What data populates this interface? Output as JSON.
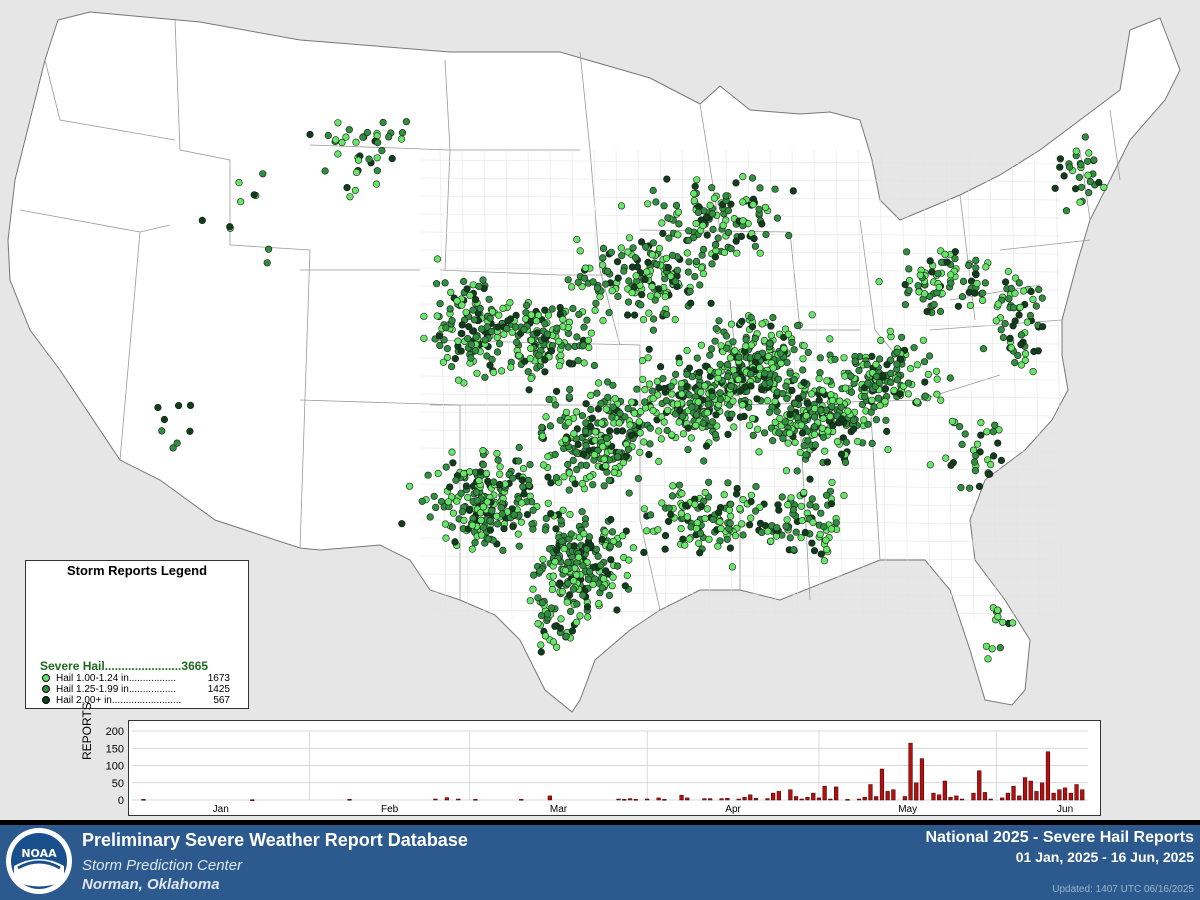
{
  "legend": {
    "title": "Storm Reports Legend",
    "summary_label": "Severe Hail.......................",
    "summary_count": "3665",
    "items": [
      {
        "label": "Hail 1.00-1.24 in.................",
        "count": "1673",
        "color": "#66e666"
      },
      {
        "label": "Hail 1.25-1.99 in.................",
        "count": "1425",
        "color": "#2f8f3f"
      },
      {
        "label": "Hail 2.00+ in.........................",
        "count": "567",
        "color": "#0f3f1a"
      }
    ],
    "summary_color": "#1e6a1e"
  },
  "chart": {
    "ylabel": "REPORTS",
    "yticks": [
      "0",
      "50",
      "100",
      "150",
      "200"
    ],
    "ymax": 200,
    "months": [
      "Jan",
      "Feb",
      "Mar",
      "Apr",
      "May",
      "Jun"
    ],
    "bar_color": "#b40f0f",
    "days": 167,
    "bars": [
      [
        2,
        2
      ],
      [
        21,
        1
      ],
      [
        38,
        2
      ],
      [
        53,
        3
      ],
      [
        55,
        7
      ],
      [
        57,
        3
      ],
      [
        60,
        2
      ],
      [
        68,
        2
      ],
      [
        73,
        12
      ],
      [
        85,
        3
      ],
      [
        86,
        2
      ],
      [
        87,
        4
      ],
      [
        88,
        2
      ],
      [
        90,
        3
      ],
      [
        92,
        6
      ],
      [
        93,
        2
      ],
      [
        96,
        14
      ],
      [
        97,
        6
      ],
      [
        100,
        4
      ],
      [
        101,
        4
      ],
      [
        103,
        4
      ],
      [
        104,
        5
      ],
      [
        106,
        3
      ],
      [
        107,
        8
      ],
      [
        108,
        15
      ],
      [
        109,
        5
      ],
      [
        111,
        4
      ],
      [
        112,
        20
      ],
      [
        113,
        25
      ],
      [
        115,
        30
      ],
      [
        116,
        10
      ],
      [
        117,
        3
      ],
      [
        118,
        8
      ],
      [
        119,
        20
      ],
      [
        120,
        6
      ],
      [
        121,
        40
      ],
      [
        122,
        3
      ],
      [
        123,
        38
      ],
      [
        125,
        2
      ],
      [
        127,
        3
      ],
      [
        128,
        8
      ],
      [
        129,
        45
      ],
      [
        130,
        10
      ],
      [
        131,
        90
      ],
      [
        132,
        25
      ],
      [
        133,
        30
      ],
      [
        135,
        10
      ],
      [
        136,
        165
      ],
      [
        137,
        50
      ],
      [
        138,
        120
      ],
      [
        140,
        20
      ],
      [
        141,
        15
      ],
      [
        142,
        55
      ],
      [
        143,
        8
      ],
      [
        144,
        12
      ],
      [
        145,
        3
      ],
      [
        147,
        20
      ],
      [
        148,
        85
      ],
      [
        149,
        22
      ],
      [
        150,
        3
      ],
      [
        152,
        6
      ],
      [
        153,
        20
      ],
      [
        154,
        40
      ],
      [
        155,
        12
      ],
      [
        156,
        65
      ],
      [
        157,
        55
      ],
      [
        158,
        25
      ],
      [
        159,
        50
      ],
      [
        160,
        140
      ],
      [
        161,
        20
      ],
      [
        162,
        30
      ],
      [
        163,
        35
      ],
      [
        164,
        20
      ],
      [
        165,
        45
      ],
      [
        166,
        30
      ]
    ],
    "colors": {
      "grid": "#cccccc",
      "axis": "#333333"
    }
  },
  "footer": {
    "title": "Preliminary Severe Weather Report Database",
    "org": "Storm Prediction Center",
    "location": "Norman, Oklahoma",
    "right_title": "National  2025 - Severe Hail Reports",
    "date_range": "01 Jan, 2025 - 16 Jun, 2025",
    "updated": "Updated: 1407 UTC 06/16/2025",
    "logo_text": "NOAA",
    "bg": "#2c5a8e"
  },
  "map": {
    "land_color": "#ffffff",
    "border_color": "#999999",
    "county_color": "#dddddd",
    "water_color": "#e6e6e6"
  }
}
